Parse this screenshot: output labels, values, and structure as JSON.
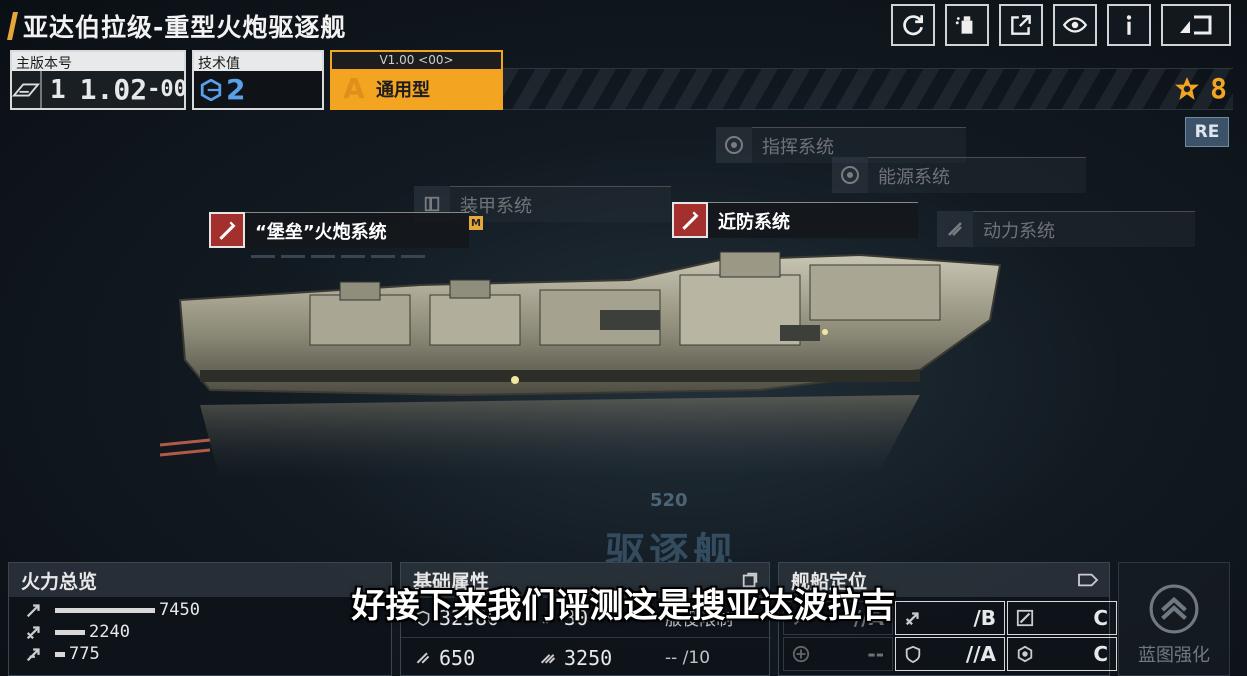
{
  "header": {
    "title": "亚达伯拉级-重型火炮驱逐舰",
    "icons": [
      "refresh-icon",
      "paint-spray-icon",
      "share-icon",
      "view-icon",
      "info-icon",
      "exit-icon"
    ]
  },
  "version": {
    "label": "主版本号",
    "main": "1",
    "minor": "1.02",
    "suffix": "-00"
  },
  "tech": {
    "label": "技术值",
    "value": "2"
  },
  "type": {
    "version_tag": "V1.00 <00>",
    "grade": "A",
    "name": "通用型"
  },
  "medal_count": "8",
  "re_badge": "RE",
  "systems": {
    "fortress_gun": "“堡垒”火炮系统",
    "fortress_tag": "M",
    "armor": "装甲系统",
    "point_defense": "近防系统",
    "command": "指挥系统",
    "energy": "能源系统",
    "propulsion": "动力系统"
  },
  "background": {
    "hull_number": "520",
    "class_text": "驱逐舰"
  },
  "firepower": {
    "title": "火力总览",
    "rows": [
      {
        "value": "7450",
        "fraction": 1.0
      },
      {
        "value": "2240",
        "fraction": 0.3
      },
      {
        "value": "775",
        "fraction": 0.1
      }
    ]
  },
  "attributes": {
    "title": "基础属性",
    "hp": "32580",
    "armor": "30",
    "service_limit_label": "服役限制",
    "speed": "650",
    "range": "3250",
    "service_limit": "-- /10"
  },
  "positioning": {
    "title": "舰船定位",
    "cells": [
      {
        "grade": "//A",
        "style": "faint"
      },
      {
        "grade": "/B",
        "style": "bright"
      },
      {
        "grade": "C",
        "style": "bright"
      },
      {
        "grade": "--",
        "style": "faint"
      },
      {
        "grade": "//A",
        "style": "bright"
      },
      {
        "grade": "C",
        "style": "bright"
      }
    ]
  },
  "enhance_label": "蓝图强化",
  "subtitle": "好接下来我们评测这是搜亚达波拉吉",
  "colors": {
    "accent_orange": "#f3a521",
    "tech_blue": "#5aa0e8",
    "system_red": "#a3302c"
  }
}
